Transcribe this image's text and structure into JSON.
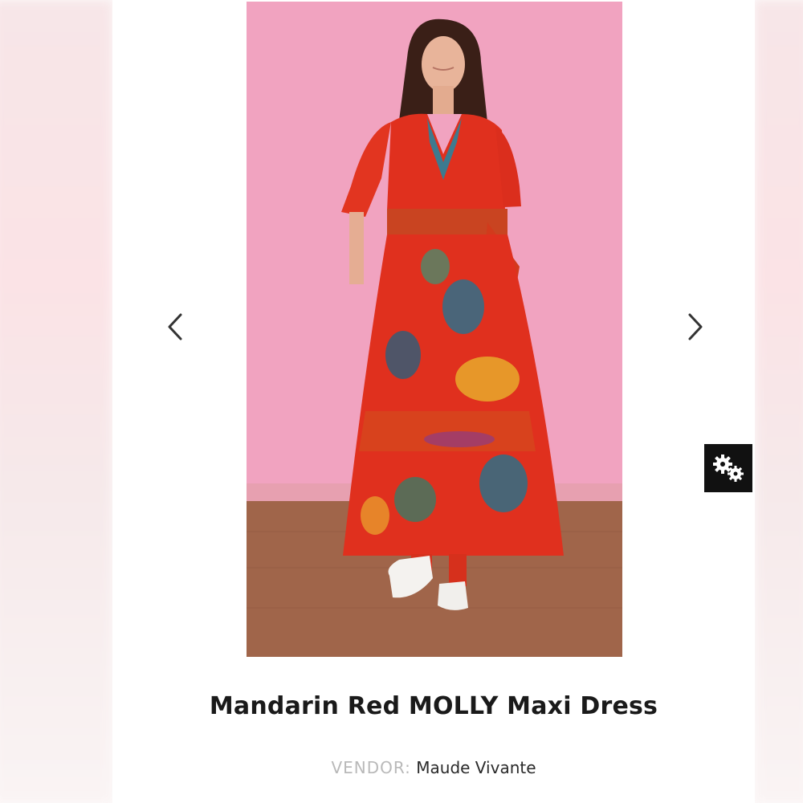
{
  "product": {
    "title": "Mandarin Red MOLLY Maxi Dress",
    "vendor_label": "VENDOR:",
    "vendor_name": "Maude Vivante",
    "image_alt": "Model wearing red floral print maxi dress against pink backdrop"
  },
  "carousel": {
    "prev_icon": "chevron-left-icon",
    "next_icon": "chevron-right-icon"
  },
  "widget": {
    "icon": "gears-icon"
  },
  "colors": {
    "backdrop_pink": "#f1a3c0",
    "floor_brown": "#a0654a",
    "dress_red": "#e0301e",
    "widget_bg": "#111111"
  }
}
